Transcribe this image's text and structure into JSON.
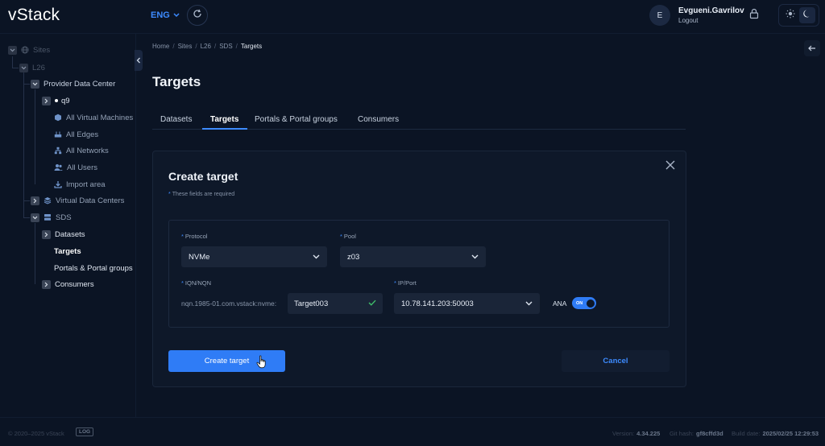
{
  "app": {
    "logo": "vStack"
  },
  "header": {
    "language": "ENG",
    "user": {
      "initial": "E",
      "name": "Evgueni.Gavrilov",
      "logout": "Logout"
    }
  },
  "sidebar": {
    "items": [
      {
        "label": "Sites"
      },
      {
        "label": "L26"
      },
      {
        "label": "Provider Data Center"
      },
      {
        "label": "q9"
      },
      {
        "label": "All Virtual Machines"
      },
      {
        "label": "All Edges"
      },
      {
        "label": "All Networks"
      },
      {
        "label": "All Users"
      },
      {
        "label": "Import area"
      },
      {
        "label": "Virtual Data Centers"
      },
      {
        "label": "SDS"
      },
      {
        "label": "Datasets"
      },
      {
        "label": "Targets"
      },
      {
        "label": "Portals & Portal groups"
      },
      {
        "label": "Consumers"
      }
    ]
  },
  "breadcrumb": [
    "Home",
    "Sites",
    "L26",
    "SDS",
    "Targets"
  ],
  "page": {
    "title": "Targets"
  },
  "tabs": [
    {
      "label": "Datasets"
    },
    {
      "label": "Targets"
    },
    {
      "label": "Portals & Portal groups"
    },
    {
      "label": "Consumers"
    }
  ],
  "dialog": {
    "title": "Create target",
    "required_note": "These fields are required",
    "protocol": {
      "label": "Protocol",
      "value": "NVMe"
    },
    "pool": {
      "label": "Pool",
      "value": "z03"
    },
    "iqn": {
      "label": "IQN/NQN",
      "prefix": "nqn.1985-01.com.vstack:nvme:",
      "value": "Target003"
    },
    "ip_port": {
      "label": "IP/Port",
      "value": "10.78.141.203:50003"
    },
    "ana": {
      "label": "ANA",
      "state": "ON"
    },
    "create_label": "Create target",
    "cancel_label": "Cancel"
  },
  "footer": {
    "copyright": "© 2020–2025 vStack",
    "log_badge": "LOG",
    "version_label": "Version:",
    "version": "4.34.225",
    "git_label": "Git hash:",
    "git": "gf8cffd3d",
    "build_label": "Build date:",
    "build": "2025/02/25 12:29:53"
  },
  "colors": {
    "accent": "#3d8bff",
    "background": "#0b1424",
    "card": "#0e1829",
    "input": "#1a2538"
  }
}
